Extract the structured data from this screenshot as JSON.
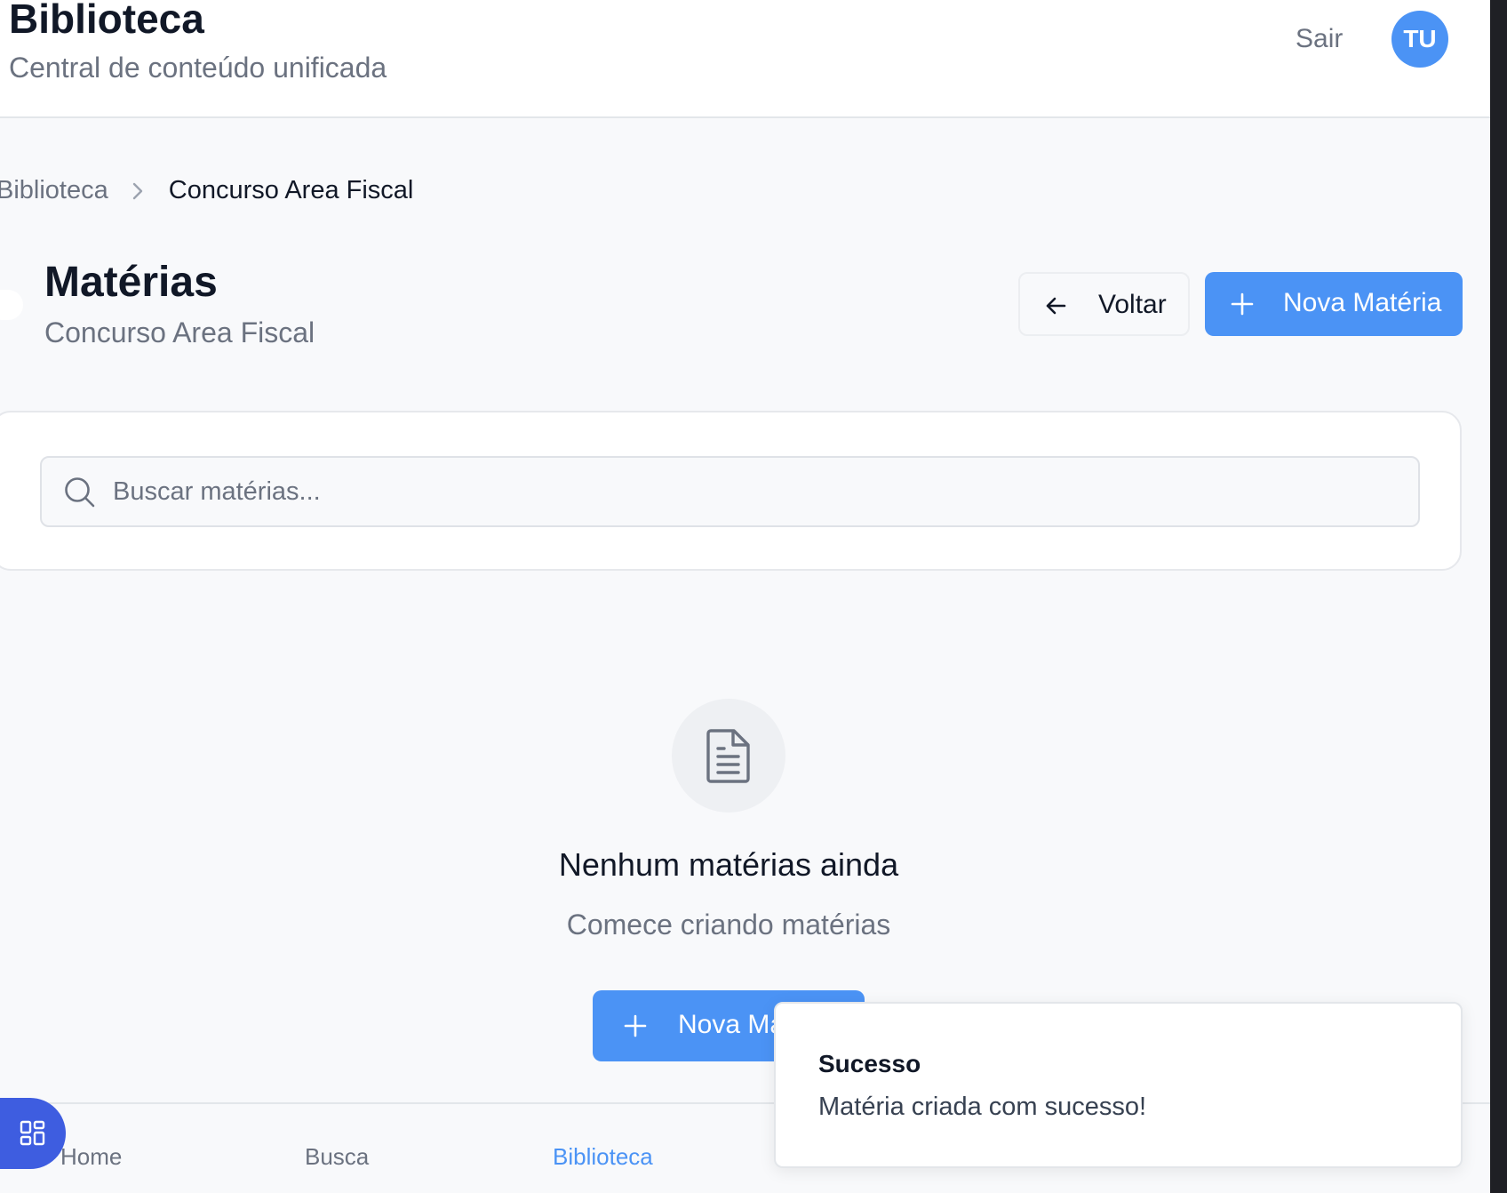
{
  "header": {
    "title": "Biblioteca",
    "subtitle": "Central de conteúdo unificada",
    "logout_label": "Sair",
    "avatar_initials": "TU"
  },
  "breadcrumb": {
    "items": [
      "Biblioteca",
      "Concurso Area Fiscal"
    ]
  },
  "page": {
    "title": "Matérias",
    "subtitle": "Concurso Area Fiscal",
    "back_label": "Voltar",
    "new_label": "Nova Matéria"
  },
  "search": {
    "placeholder": "Buscar matérias...",
    "value": ""
  },
  "empty_state": {
    "title": "Nenhum matérias ainda",
    "subtitle": "Comece criando matérias",
    "button_label": "Nova Matéria"
  },
  "bottom_nav": {
    "items": [
      {
        "label": "Home"
      },
      {
        "label": "Busca"
      },
      {
        "label": "Biblioteca",
        "active": true
      }
    ]
  },
  "toast": {
    "title": "Sucesso",
    "message": "Matéria criada com sucesso!"
  },
  "colors": {
    "accent": "#4b93f5",
    "fab": "#3e5de0",
    "background": "#f8f9fb"
  }
}
